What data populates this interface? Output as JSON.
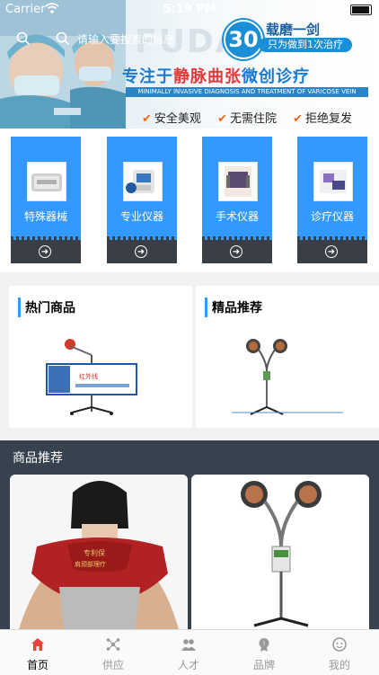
{
  "status": {
    "carrier": "Carrier",
    "time": "5:19 PM"
  },
  "banner": {
    "watermark": "FUDA",
    "badge_number": "30",
    "slogan_top": "载磨一剑",
    "slogan_sub": "只为做到1次治疗",
    "headline_a": "专注于",
    "headline_b": "静脉曲张",
    "headline_c": "微创诊疗",
    "subline": "MINIMALLY INVASIVE DIAGNOSIS AND TREATMENT OF VARICOSE VEIN",
    "features": [
      "安全美观",
      "无需住院",
      "拒绝复发"
    ]
  },
  "search": {
    "placeholder": "请输入要搜索的信息"
  },
  "categories": [
    {
      "label": "特殊器械",
      "icon": "instrument-box-icon"
    },
    {
      "label": "专业仪器",
      "icon": "blood-pressure-monitor-icon"
    },
    {
      "label": "手术仪器",
      "icon": "surgical-device-icon"
    },
    {
      "label": "诊疗仪器",
      "icon": "diagnostic-device-icon"
    }
  ],
  "hot": {
    "title": "热门商品"
  },
  "featured": {
    "title": "精品推荐"
  },
  "recommend": {
    "title": "商品推荐"
  },
  "tabs": [
    {
      "label": "首页",
      "icon": "home-icon",
      "active": true
    },
    {
      "label": "供应",
      "icon": "supply-icon",
      "active": false
    },
    {
      "label": "人才",
      "icon": "people-icon",
      "active": false
    },
    {
      "label": "品牌",
      "icon": "brand-icon",
      "active": false
    },
    {
      "label": "我的",
      "icon": "profile-icon",
      "active": false
    }
  ],
  "colors": {
    "accent": "#3399ff",
    "active_tab": "#e8443a",
    "dark": "#37424f"
  }
}
